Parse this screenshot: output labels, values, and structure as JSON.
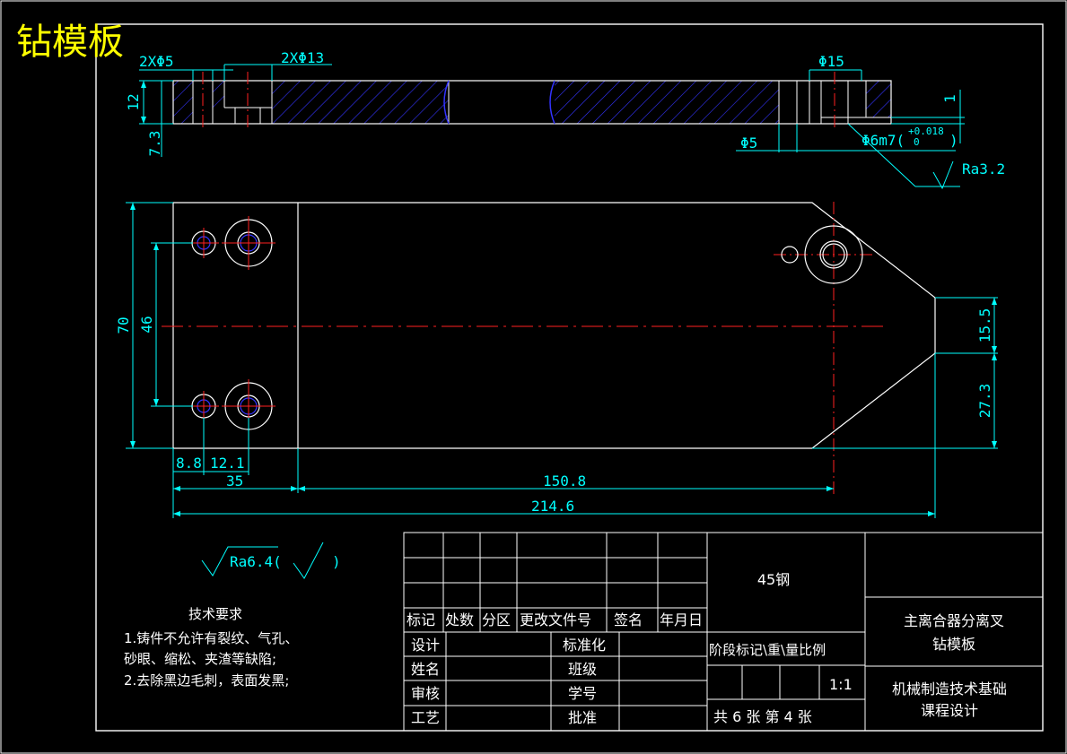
{
  "drawing_title": "钻模板",
  "dims": {
    "top_2x_phi5": "2XΦ5",
    "top_2x_phi13": "2XΦ13",
    "top_phi15": "Φ15",
    "top_12": "12",
    "top_7_3": "7.3",
    "top_1": "1",
    "top_phi5": "Φ5",
    "top_phi6m7": "Φ6m7(",
    "tol_upper": "+0.018",
    "tol_lower": "0",
    "tol_close": ")",
    "top_ra32": "Ra3.2",
    "v_70": "70",
    "v_46": "46",
    "v_15_5": "15.5",
    "v_27_3": "27.3",
    "h_8_8": "8.8",
    "h_12_1": "12.1",
    "h_35": "35",
    "h_150_8": "150.8",
    "h_214_6": "214.6"
  },
  "roughness_note": {
    "ra": "Ra6.4(",
    "close": ")"
  },
  "tech_req": {
    "heading": "技术要求",
    "line1": "1.铸件不允许有裂纹、气孔、",
    "line2": "砂眼、缩松、夹渣等缺陷;",
    "line3": "2.去除黑边毛刺，表面发黑;"
  },
  "title_block": {
    "material": "45钢",
    "part_name_1": "主离合器分离叉",
    "part_name_2": "钻模板",
    "org_1": "机械制造技术基础",
    "org_2": "课程设计",
    "hdr_mark": "标记",
    "hdr_count": "处数",
    "hdr_zone": "分区",
    "hdr_change": "更改文件号",
    "hdr_sign": "签名",
    "hdr_date": "年月日",
    "row_design": "设计",
    "row_name": "姓名",
    "row_check": "审核",
    "row_process": "工艺",
    "std": "标准化",
    "class": "班级",
    "student_no": "学号",
    "approve": "批准",
    "stage_header": "阶段标记\\重\\量比例",
    "scale": "1:1",
    "sheets": "共 6 张 第 4 张"
  }
}
